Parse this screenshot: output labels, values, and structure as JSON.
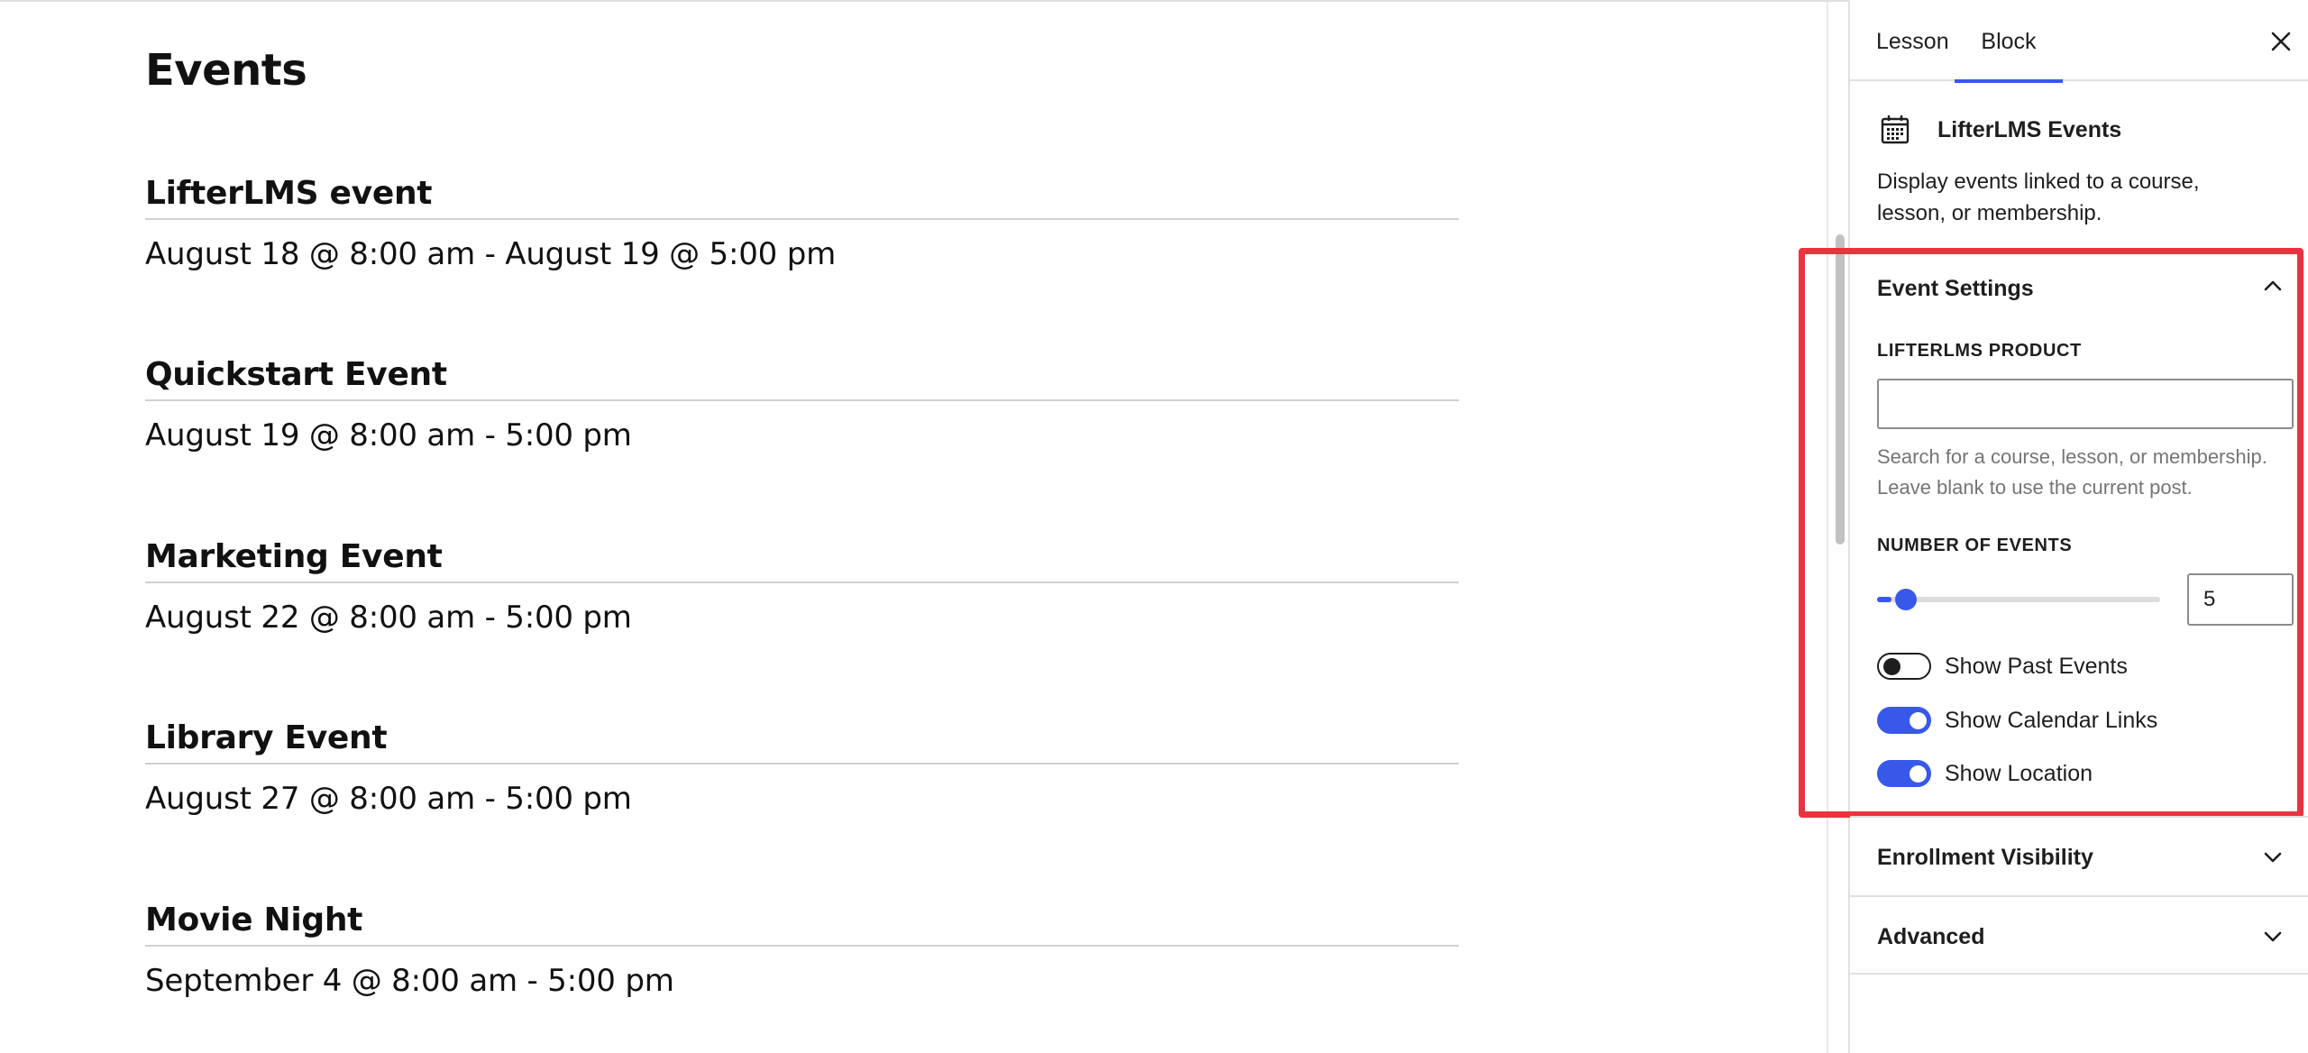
{
  "editor": {
    "heading": "Events",
    "events": [
      {
        "name": "LifterLMS event",
        "date": "August 18 @ 8:00 am - August 19 @ 5:00 pm"
      },
      {
        "name": "Quickstart Event",
        "date": "August 19 @ 8:00 am - 5:00 pm"
      },
      {
        "name": "Marketing Event",
        "date": "August 22 @ 8:00 am - 5:00 pm"
      },
      {
        "name": "Library Event",
        "date": "August 27 @ 8:00 am - 5:00 pm"
      },
      {
        "name": "Movie Night",
        "date": "September 4 @ 8:00 am - 5:00 pm"
      }
    ]
  },
  "sidebar": {
    "tabs": [
      {
        "label": "Lesson",
        "active": false
      },
      {
        "label": "Block",
        "active": true
      }
    ],
    "close_icon": "close-icon",
    "block": {
      "icon": "calendar-icon",
      "name": "LifterLMS Events",
      "description": "Display events linked to a course, lesson, or membership."
    },
    "event_settings": {
      "title": "Event Settings",
      "product_label": "LifterLMS Product",
      "product_value": "",
      "help_text": "Search for a course, lesson, or membership. Leave blank to use the current post.",
      "number_label": "Number of Events",
      "number_value": "5",
      "slider_fraction": 0.05,
      "toggles": [
        {
          "label": "Show Past Events",
          "on": false
        },
        {
          "label": "Show Calendar Links",
          "on": true
        },
        {
          "label": "Show Location",
          "on": true
        }
      ]
    },
    "panels": [
      {
        "title": "Enrollment Visibility"
      },
      {
        "title": "Advanced"
      }
    ]
  },
  "colors": {
    "accent": "#3858e9",
    "highlight": "#e8343f",
    "help_text": "#757575"
  }
}
